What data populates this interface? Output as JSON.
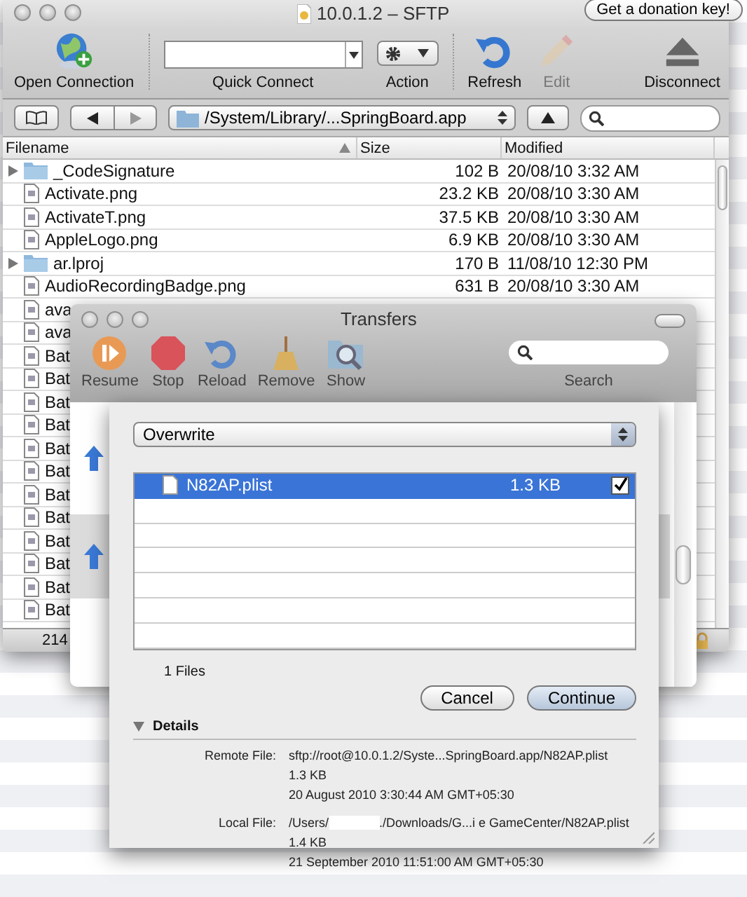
{
  "window": {
    "title": "10.0.1.2 – SFTP",
    "donation_button": "Get a donation key!"
  },
  "toolbar": {
    "open_connection": "Open Connection",
    "quick_connect": "Quick Connect",
    "action": "Action",
    "refresh": "Refresh",
    "edit": {
      "label": "Edit",
      "disabled": true
    },
    "disconnect": "Disconnect"
  },
  "path_bar": {
    "path": "/System/Library/...SpringBoard.app"
  },
  "table": {
    "columns": [
      {
        "label": "Filename",
        "sorted": true
      },
      {
        "label": "Size",
        "sorted": false
      },
      {
        "label": "Modified",
        "sorted": false
      }
    ],
    "rows": [
      {
        "name": "_CodeSignature",
        "kind": "folder",
        "size": "102 B",
        "modified": "20/08/10 3:32 AM"
      },
      {
        "name": "Activate.png",
        "kind": "file",
        "size": "23.2 KB",
        "modified": "20/08/10 3:30 AM"
      },
      {
        "name": "ActivateT.png",
        "kind": "file",
        "size": "37.5 KB",
        "modified": "20/08/10 3:30 AM"
      },
      {
        "name": "AppleLogo.png",
        "kind": "file",
        "size": "6.9 KB",
        "modified": "20/08/10 3:30 AM"
      },
      {
        "name": "ar.lproj",
        "kind": "folder",
        "size": "170 B",
        "modified": "11/08/10 12:30 PM"
      },
      {
        "name": "AudioRecordingBadge.png",
        "kind": "file",
        "size": "631 B",
        "modified": "20/08/10 3:30 AM"
      },
      {
        "name": "ava",
        "kind": "file"
      },
      {
        "name": "ava",
        "kind": "file"
      },
      {
        "name": "Bat",
        "kind": "file"
      },
      {
        "name": "Bat",
        "kind": "file"
      },
      {
        "name": "Bat",
        "kind": "file"
      },
      {
        "name": "Bat",
        "kind": "file"
      },
      {
        "name": "Bat",
        "kind": "file"
      },
      {
        "name": "Bat",
        "kind": "file"
      },
      {
        "name": "Bat",
        "kind": "file"
      },
      {
        "name": "Bat",
        "kind": "file"
      },
      {
        "name": "Bat",
        "kind": "file"
      },
      {
        "name": "Bat",
        "kind": "file"
      },
      {
        "name": "Bat",
        "kind": "file"
      },
      {
        "name": "Bat",
        "kind": "file"
      }
    ]
  },
  "status_bar": "214",
  "transfers": {
    "title": "Transfers",
    "tools": [
      {
        "label": "Resume",
        "kind": "resume"
      },
      {
        "label": "Stop",
        "kind": "stop"
      },
      {
        "label": "Reload",
        "kind": "reload"
      },
      {
        "label": "Remove",
        "kind": "remove"
      },
      {
        "label": "Show",
        "kind": "show"
      }
    ],
    "search_label": "Search"
  },
  "sheet": {
    "conflict_action": "Overwrite",
    "files": [
      {
        "name": "N82AP.plist",
        "size": "1.3 KB",
        "checked": true,
        "selected": true
      }
    ],
    "count": "1 Files",
    "buttons": [
      {
        "label": "Cancel",
        "default": false
      },
      {
        "label": "Continue",
        "default": true
      }
    ],
    "details": {
      "label": "Details",
      "expanded": true,
      "remote": {
        "label": "Remote File:",
        "path": "sftp://root@10.0.1.2/Syste...SpringBoard.app/N82AP.plist",
        "size": "1.3 KB",
        "date": "20 August 2010 3:30:44 AM GMT+05:30"
      },
      "local": {
        "label": "Local File:",
        "path_start": "/Users/",
        "path_end": "./Downloads/G...i e GameCenter/N82AP.plist",
        "size": "1.4 KB",
        "date": "21 September 2010 11:51:00 AM GMT+05:30"
      }
    }
  }
}
